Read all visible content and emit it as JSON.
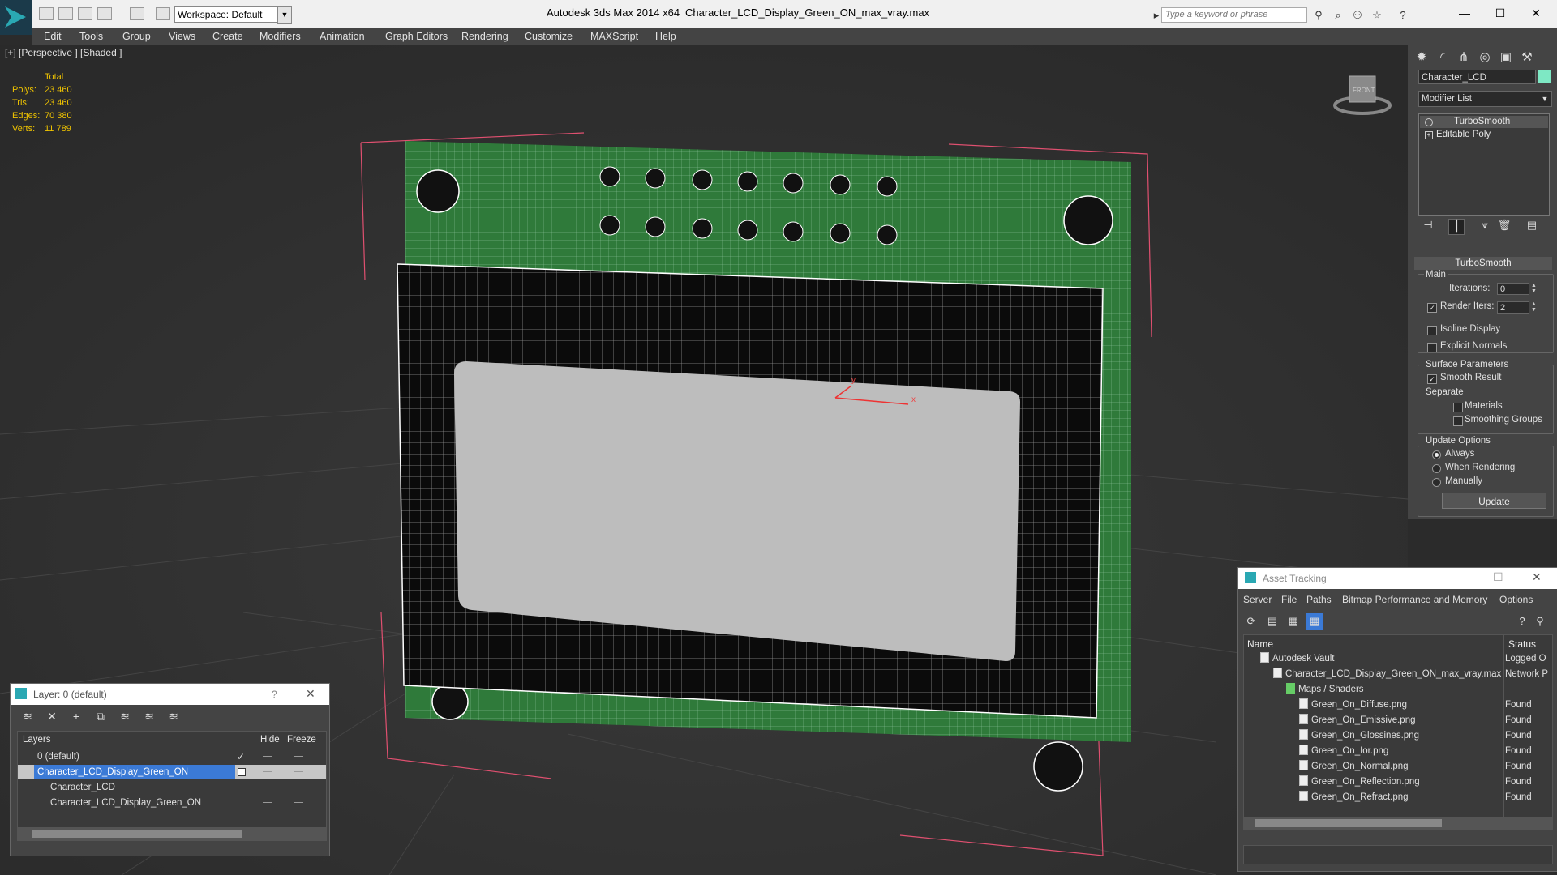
{
  "app": {
    "title": "Autodesk 3ds Max  2014 x64",
    "file": "Character_LCD_Display_Green_ON_max_vray.max",
    "workspace": "Workspace: Default",
    "search_placeholder": "Type a keyword or phrase"
  },
  "menu": [
    "Edit",
    "Tools",
    "Group",
    "Views",
    "Create",
    "Modifiers",
    "Animation",
    "Graph Editors",
    "Rendering",
    "Customize",
    "MAXScript",
    "Help"
  ],
  "viewport": {
    "label": "[+] [Perspective ] [Shaded ]",
    "stats_header": "Total",
    "stats": [
      {
        "label": "Polys:",
        "value": "23 460"
      },
      {
        "label": "Tris:",
        "value": "23 460"
      },
      {
        "label": "Edges:",
        "value": "70 380"
      },
      {
        "label": "Verts:",
        "value": "11 789"
      }
    ],
    "gizmo_label": "FRONT",
    "axis_x": "x",
    "axis_y": "y"
  },
  "command_panel": {
    "object_name": "Character_LCD",
    "object_color": "#7ee8c4",
    "modifier_list": "Modifier List",
    "stack": [
      "TurboSmooth",
      "Editable Poly"
    ],
    "rollout_title": "TurboSmooth",
    "main_label": "Main",
    "iterations_label": "Iterations:",
    "iterations_value": "0",
    "render_iters_label": "Render Iters:",
    "render_iters_value": "2",
    "isoline_label": "Isoline Display",
    "explicit_normals_label": "Explicit Normals",
    "surface_params_label": "Surface Parameters",
    "smooth_result_label": "Smooth Result",
    "separate_label": "Separate",
    "materials_label": "Materials",
    "smoothing_groups_label": "Smoothing Groups",
    "update_options_label": "Update Options",
    "always_label": "Always",
    "when_rendering_label": "When Rendering",
    "manually_label": "Manually",
    "update_button": "Update"
  },
  "layer_panel": {
    "title": "Layer: 0 (default)",
    "help": "?",
    "col_layers": "Layers",
    "col_hide": "Hide",
    "col_freeze": "Freeze",
    "rows": [
      {
        "name": "0 (default)"
      },
      {
        "name": "Character_LCD_Display_Green_ON"
      },
      {
        "name": "Character_LCD"
      },
      {
        "name": "Character_LCD_Display_Green_ON"
      }
    ]
  },
  "asset_tracking": {
    "title": "Asset Tracking",
    "menu": [
      "Server",
      "File",
      "Paths",
      "Bitmap Performance and Memory",
      "Options"
    ],
    "col_name": "Name",
    "col_status": "Status",
    "rows": [
      {
        "name": "Autodesk Vault",
        "status": "Logged O"
      },
      {
        "name": "Character_LCD_Display_Green_ON_max_vray.max",
        "status": "Network P"
      },
      {
        "name": "Maps / Shaders",
        "status": ""
      },
      {
        "name": "Green_On_Diffuse.png",
        "status": "Found"
      },
      {
        "name": "Green_On_Emissive.png",
        "status": "Found"
      },
      {
        "name": "Green_On_Glossines.png",
        "status": "Found"
      },
      {
        "name": "Green_On_Ior.png",
        "status": "Found"
      },
      {
        "name": "Green_On_Normal.png",
        "status": "Found"
      },
      {
        "name": "Green_On_Reflection.png",
        "status": "Found"
      },
      {
        "name": "Green_On_Refract.png",
        "status": "Found"
      }
    ]
  }
}
